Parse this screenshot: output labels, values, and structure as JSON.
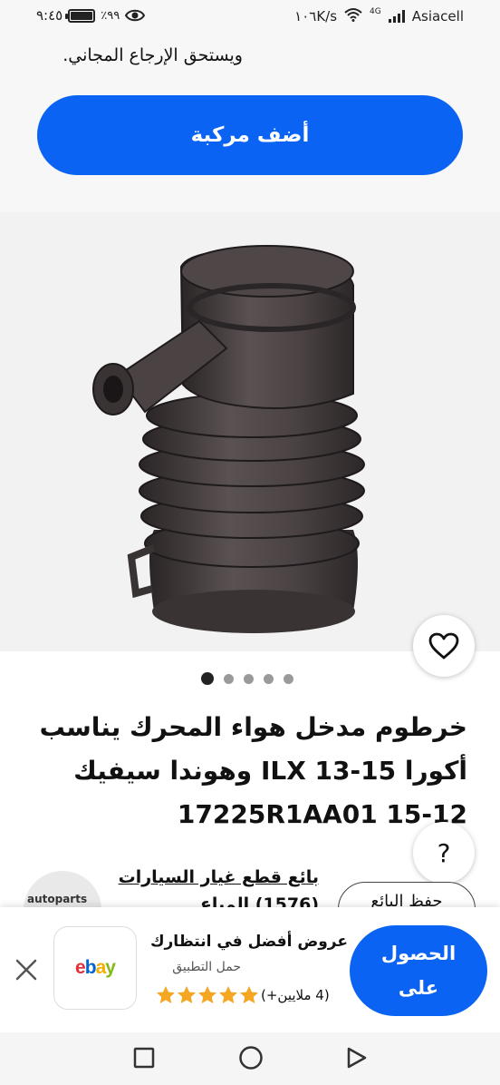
{
  "status_bar": {
    "time": "٩:٤٥",
    "battery": "٪٩٩",
    "battery_level": 0.99,
    "speed": "١٠٦K/s",
    "network_type": "4G",
    "carrier": "Asiacell",
    "icons": [
      "eye-icon",
      "battery-icon",
      "wifi-icon",
      "signal-icon"
    ]
  },
  "top": {
    "return_text": "ويستحق الإرجاع المجاني.",
    "add_vehicle_label": "أضف مركبة"
  },
  "gallery": {
    "dots_total": 5,
    "active_dot": 1,
    "favorite_icon": "heart-icon"
  },
  "product": {
    "title": "خرطوم مدخل هواء المحرك يناسب أكورا ILX 13-15 وهوندا سيفيك 12-17225R1AA01 15"
  },
  "help": {
    "label": "?"
  },
  "seller": {
    "name": "بائع قطع غيار السيارات",
    "name_line2": "(1576) المباع",
    "logo_text": "autoparts",
    "save_label": "حفظ البائع"
  },
  "app_banner": {
    "title": "عروض أفضل في انتظارك",
    "subtitle": "حمل التطبيق",
    "rating_count": "(4 ملايين+)",
    "stars": 5,
    "get_label": "الحصول على",
    "logo_text": "ebay",
    "logo_colors": [
      "#e53238",
      "#0064d2",
      "#f5af02",
      "#86b817"
    ]
  },
  "nav_bar": {
    "icons": [
      "recents-square-icon",
      "home-circle-icon",
      "back-triangle-icon"
    ]
  },
  "colors": {
    "accent": "#0a63f2",
    "star": "#f5a623"
  }
}
